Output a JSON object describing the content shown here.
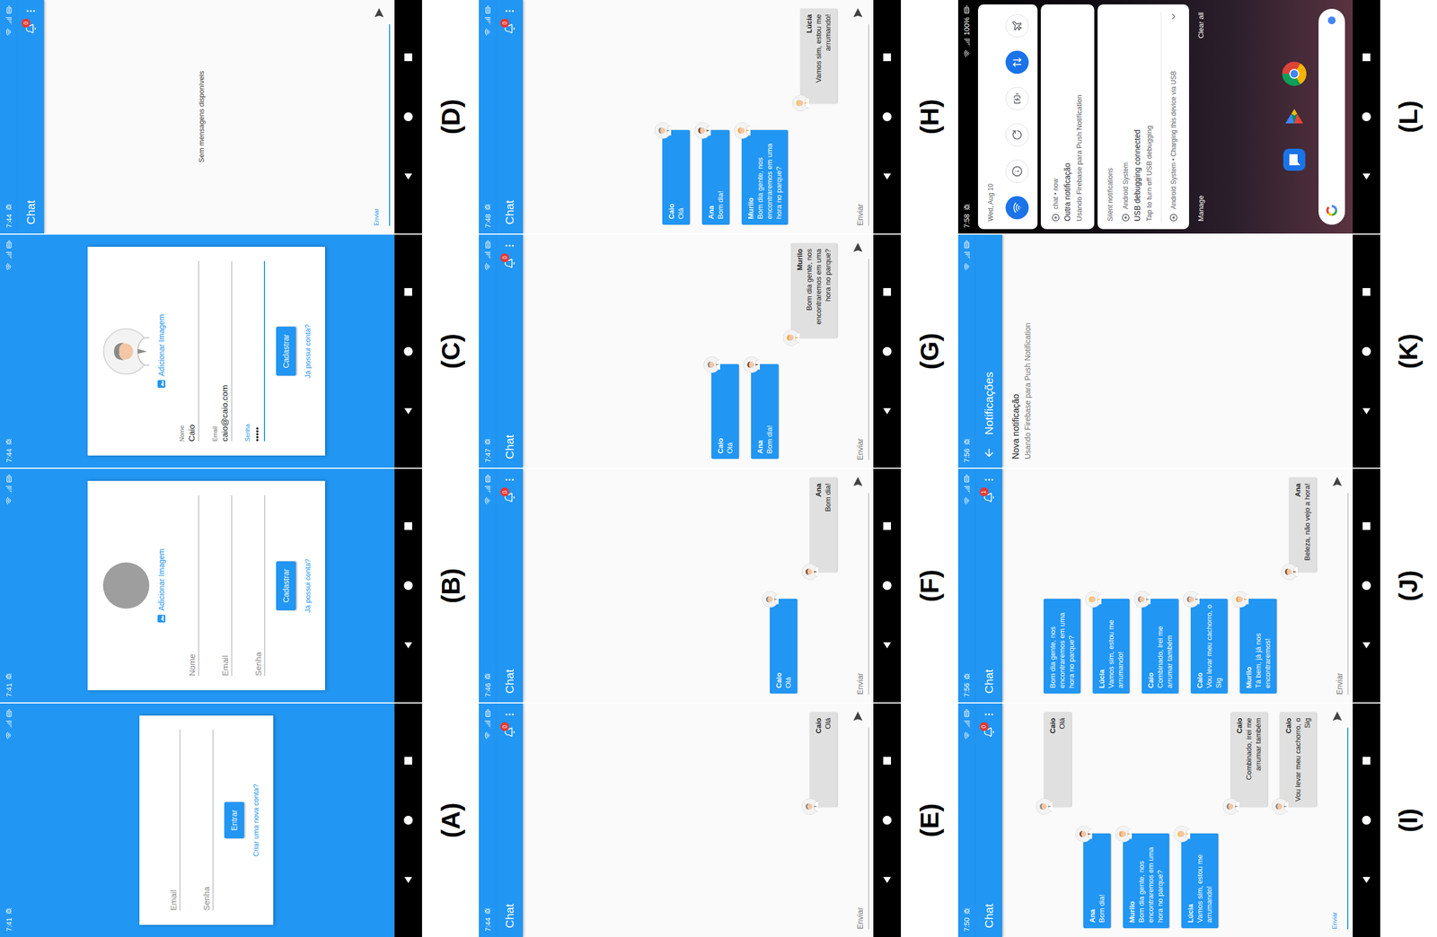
{
  "figure": {
    "panels": [
      {
        "label": "(A)",
        "kind": "login",
        "status": {
          "time": "7:41"
        },
        "form": {
          "photo": null,
          "add_image": "",
          "fields": [
            {
              "label": "Email",
              "value": "",
              "focused": false
            },
            {
              "label": "Senha",
              "value": "",
              "focused": false
            }
          ],
          "button": "Entrar",
          "link": "Criar uma nova conta?"
        }
      },
      {
        "label": "(B)",
        "kind": "register",
        "status": {
          "time": "7:41"
        },
        "form": {
          "photo": false,
          "add_image": "Adicionar Imagem",
          "fields": [
            {
              "label": "Nome",
              "value": "",
              "focused": false
            },
            {
              "label": "Email",
              "value": "",
              "focused": false
            },
            {
              "label": "Senha",
              "value": "",
              "focused": false
            }
          ],
          "button": "Cadastrar",
          "link": "Já possui conta?"
        }
      },
      {
        "label": "(C)",
        "kind": "register",
        "status": {
          "time": "7:44"
        },
        "form": {
          "photo": true,
          "add_image": "Adicionar Imagem",
          "fields": [
            {
              "label": "Nome",
              "value": "Caio",
              "focused": false
            },
            {
              "label": "Email",
              "value": "caio@caio.com",
              "focused": false
            },
            {
              "label": "Senha",
              "value": "•••••",
              "focused": true
            }
          ],
          "button": "Cadastrar",
          "link": "Já possui conta?"
        }
      },
      {
        "label": "(D)",
        "kind": "chat",
        "status": {
          "time": "7:44"
        },
        "title": "Chat",
        "badge": "0",
        "empty_text": "Sem mensagens disponíveis",
        "messages": [],
        "input": {
          "placeholder": "Enviar",
          "focused": true
        }
      },
      {
        "label": "(E)",
        "kind": "chat",
        "status": {
          "time": "7:44"
        },
        "title": "Chat",
        "badge": "0",
        "empty_text": "",
        "messages": [
          {
            "name": "Caio",
            "text": "Olá",
            "mine": true,
            "color": "#8a8a8a"
          }
        ],
        "input": {
          "placeholder": "Enviar",
          "focused": false
        }
      },
      {
        "label": "(F)",
        "kind": "chat",
        "status": {
          "time": "7:46"
        },
        "title": "Chat",
        "badge": "0",
        "empty_text": "",
        "messages": [
          {
            "name": "Caio",
            "text": "Olá",
            "mine": false,
            "color": "#8a8a8a"
          },
          {
            "name": "Ana",
            "text": "Bom dia!",
            "mine": true,
            "color": "#7b4a2e"
          }
        ],
        "input": {
          "placeholder": "Enviar",
          "focused": false
        }
      },
      {
        "label": "(G)",
        "kind": "chat",
        "status": {
          "time": "7:47"
        },
        "title": "Chat",
        "badge": "0",
        "empty_text": "",
        "messages": [
          {
            "name": "Caio",
            "text": "Olá",
            "mine": false,
            "color": "#8a8a8a"
          },
          {
            "name": "Ana",
            "text": "Bom dia!",
            "mine": false,
            "color": "#7b4a2e"
          },
          {
            "name": "Murilo",
            "text": "Bom dia gente, nos encontraremos em uma hora no parque?",
            "mine": true,
            "color": "#f2a33a"
          }
        ],
        "input": {
          "placeholder": "Enviar",
          "focused": false
        }
      },
      {
        "label": "(H)",
        "kind": "chat",
        "status": {
          "time": "7:48"
        },
        "title": "Chat",
        "badge": "0",
        "empty_text": "",
        "messages": [
          {
            "name": "Caio",
            "text": "Olá",
            "mine": false,
            "color": "#8a8a8a"
          },
          {
            "name": "Ana",
            "text": "Bom dia!",
            "mine": false,
            "color": "#7b4a2e"
          },
          {
            "name": "Murilo",
            "text": "Bom dia gente, nos encontraremos em uma hora no parque?",
            "mine": false,
            "color": "#f2a33a"
          },
          {
            "name": "Lúcia",
            "text": "Vamos sim, estou me arrumando!",
            "mine": true,
            "color": "#f4c542"
          }
        ],
        "input": {
          "placeholder": "Enviar",
          "focused": false
        }
      },
      {
        "label": "(I)",
        "kind": "chat",
        "status": {
          "time": "7:50"
        },
        "title": "Chat",
        "badge": "0",
        "empty_text": "",
        "messages": [
          {
            "name": "Caio",
            "text": "Olá",
            "mine": true,
            "color": "#8a8a8a"
          },
          {
            "name": "Ana",
            "text": "Bom dia!",
            "mine": false,
            "color": "#7b4a2e"
          },
          {
            "name": "Murilo",
            "text": "Bom dia gente, nos encontraremos em uma hora no parque?",
            "mine": false,
            "color": "#f2a33a"
          },
          {
            "name": "Lúcia",
            "text": "Vamos sim, estou me arrumando!",
            "mine": false,
            "color": "#f4c542"
          },
          {
            "name": "Caio",
            "text": "Combinado, irei me arrumar também",
            "mine": true,
            "color": "#8a8a8a"
          },
          {
            "name": "Caio",
            "text": "Vou levar meu cachorro, o Sig",
            "mine": true,
            "color": "#8a8a8a"
          }
        ],
        "input": {
          "placeholder": "Enviar",
          "focused": true
        }
      },
      {
        "label": "(J)",
        "kind": "chat",
        "status": {
          "time": "7:56"
        },
        "title": "Chat",
        "badge": "1",
        "empty_text": "",
        "messages": [
          {
            "name": "",
            "text": "Bom dia gente, nos encontraremos em uma hora no parque?",
            "mine": false
          },
          {
            "name": "Lúcia",
            "text": "Vamos sim, estou me arrumando!",
            "mine": false,
            "color": "#f4c542"
          },
          {
            "name": "Caio",
            "text": "Combinado, irei me arrumar também",
            "mine": false,
            "color": "#8a8a8a"
          },
          {
            "name": "Caio",
            "text": "Vou levar meu cachorro, o Sig",
            "mine": false,
            "color": "#8a8a8a"
          },
          {
            "name": "Murilo",
            "text": "Tá bem, já já nos encontraremos!",
            "mine": false,
            "color": "#f2a33a"
          },
          {
            "name": "Ana",
            "text": "Beleza, não vejo a hora!",
            "mine": true,
            "color": "#7b4a2e"
          }
        ],
        "input": {
          "placeholder": "Enviar",
          "focused": false
        }
      },
      {
        "label": "(K)",
        "kind": "notifications",
        "status": {
          "time": "7:56"
        },
        "title": "Notificações",
        "items": [
          {
            "title": "Nova notificação",
            "text": "Usando Firebase para Push Notification"
          }
        ]
      },
      {
        "label": "(L)",
        "kind": "shade",
        "status": {
          "time": "7:58",
          "battery": "100%"
        },
        "date": "Wed, Aug 10",
        "tiles": [
          {
            "kind": "wifi",
            "on": true
          },
          {
            "kind": "info",
            "on": false
          },
          {
            "kind": "rotate",
            "on": false
          },
          {
            "kind": "battery",
            "on": false
          },
          {
            "kind": "data",
            "on": true
          },
          {
            "kind": "airplane",
            "on": false
          }
        ],
        "notifications": [
          {
            "header": "chat • now",
            "title": "Outra notificação",
            "text": "Usando Firebase para Push Notification"
          }
        ],
        "silent": {
          "header": "Silent notifications",
          "items": [
            {
              "header": "Android System",
              "title": "USB debugging connected",
              "text": "Tap to turn off USB debugging",
              "expanded": true
            },
            {
              "header": "Android System • Charging this device via USB",
              "title": "",
              "text": "",
              "expanded": false
            }
          ]
        },
        "actions": [
          "Manage",
          "Clear all"
        ],
        "dock": [
          {
            "kind": "messages"
          },
          {
            "kind": "play"
          },
          {
            "kind": "chrome"
          }
        ]
      }
    ]
  }
}
